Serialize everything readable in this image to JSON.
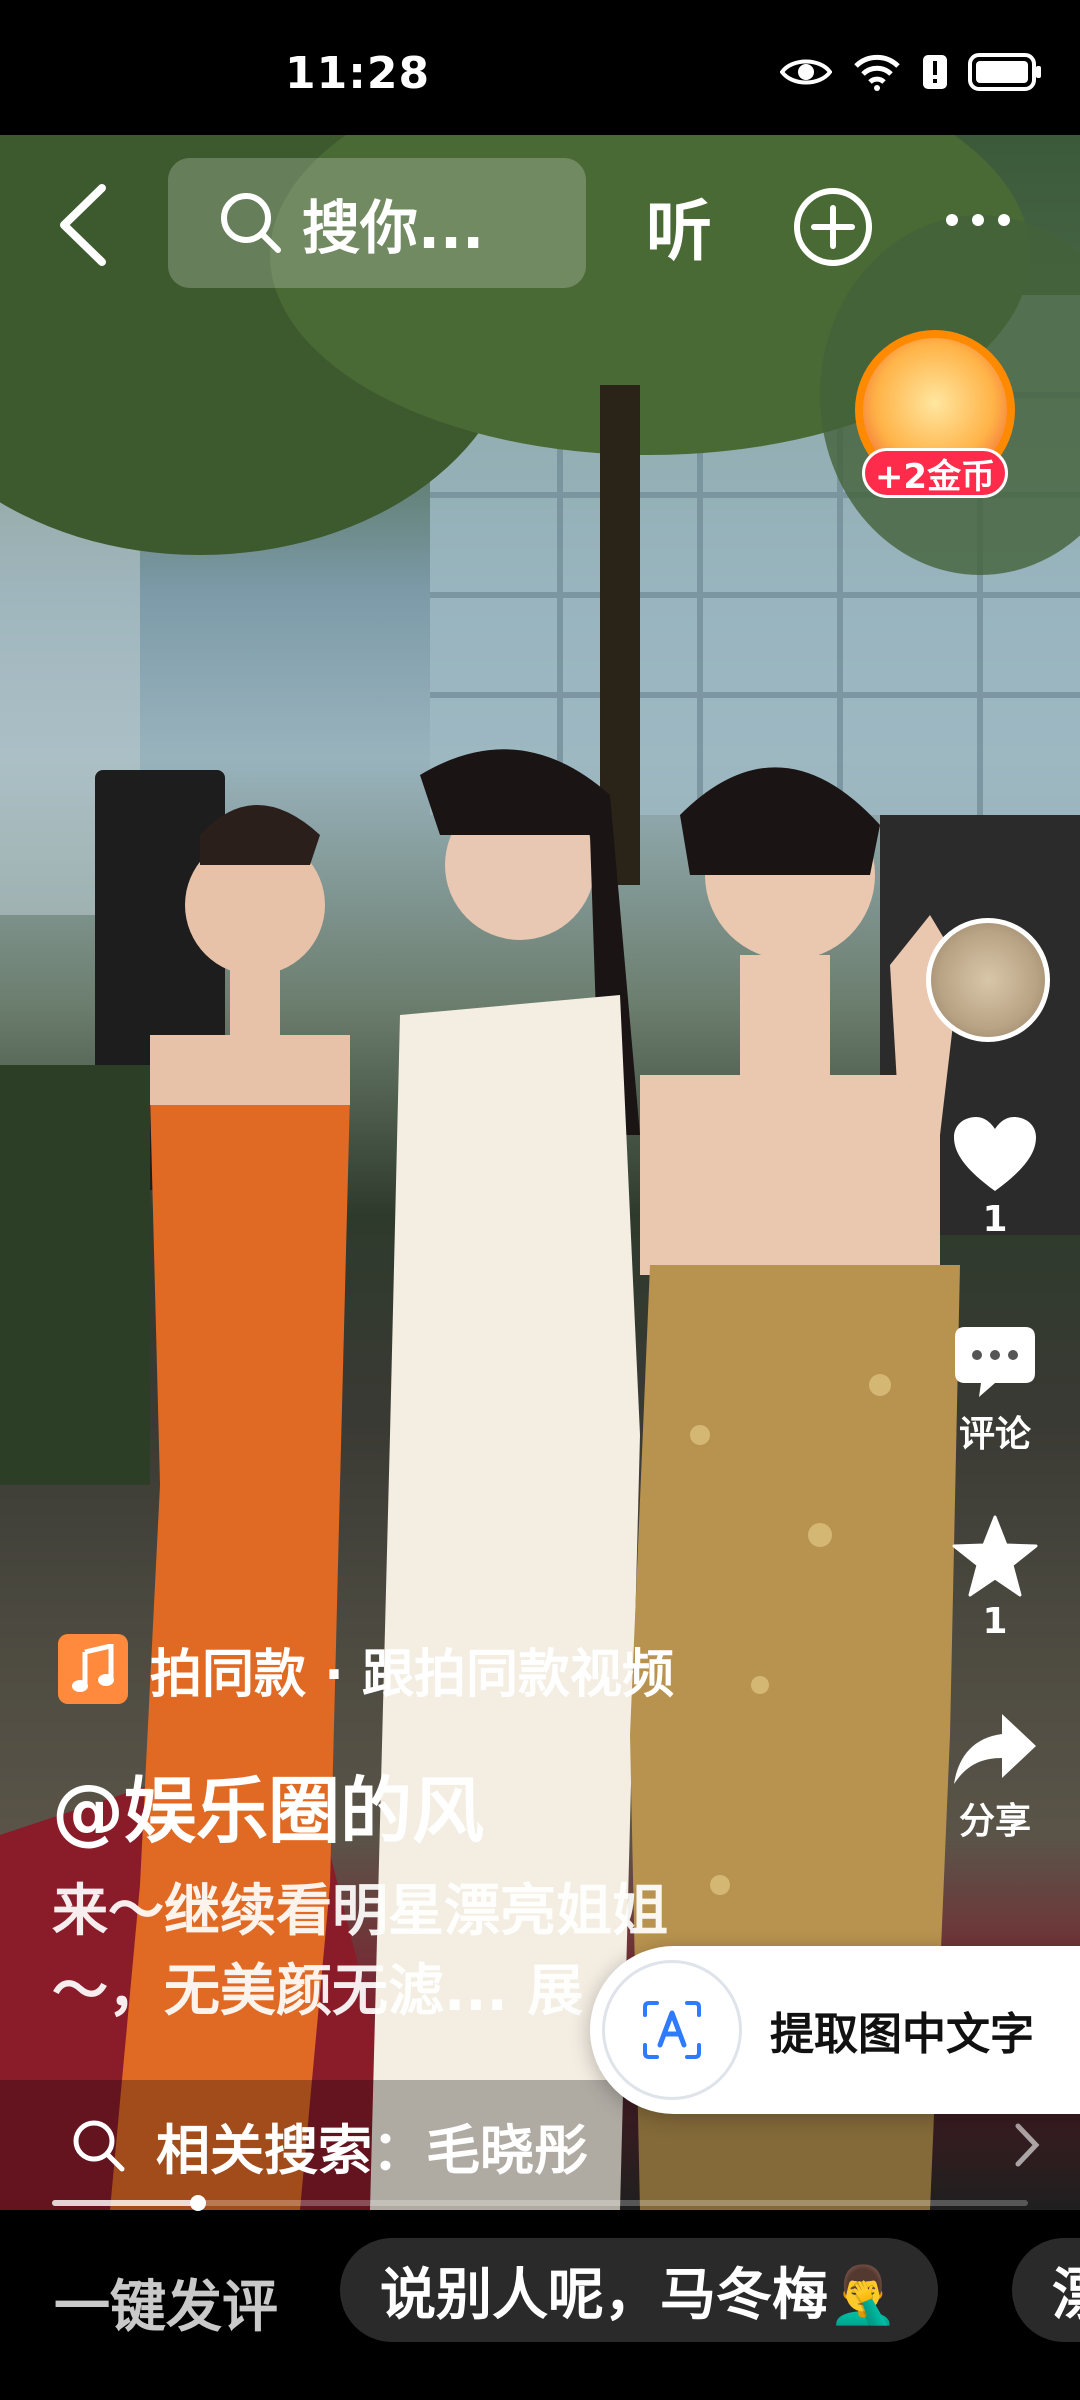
{
  "status_bar": {
    "time": "11:28"
  },
  "top_nav": {
    "search_placeholder": "搜你...",
    "listen_label": "听"
  },
  "coin_badge": {
    "label": "+2金币"
  },
  "rail": {
    "like_count": "1",
    "comment_label": "评论",
    "favorite_count": "1",
    "share_label": "分享"
  },
  "video": {
    "same_style_text": "拍同款 · 跟拍同款视频",
    "author": "@娱乐圈的风",
    "description_line1": "来～继续看明星漂亮姐姐",
    "description_line2": "～，无美颜无滤... 展",
    "progress_percent": 15
  },
  "extract_text": {
    "label": "提取图中文字"
  },
  "related_search": {
    "label": "相关搜索：",
    "query": "毛晓彤"
  },
  "comment_bar": {
    "one_click_label": "一键发评",
    "chips": [
      "说别人呢，马冬梅🤦‍♂️",
      "漂"
    ]
  },
  "colors": {
    "accent_orange": "#ff8a3d",
    "coin_red": "#ff2b4a",
    "chip_bg": "#2a2a2a"
  }
}
